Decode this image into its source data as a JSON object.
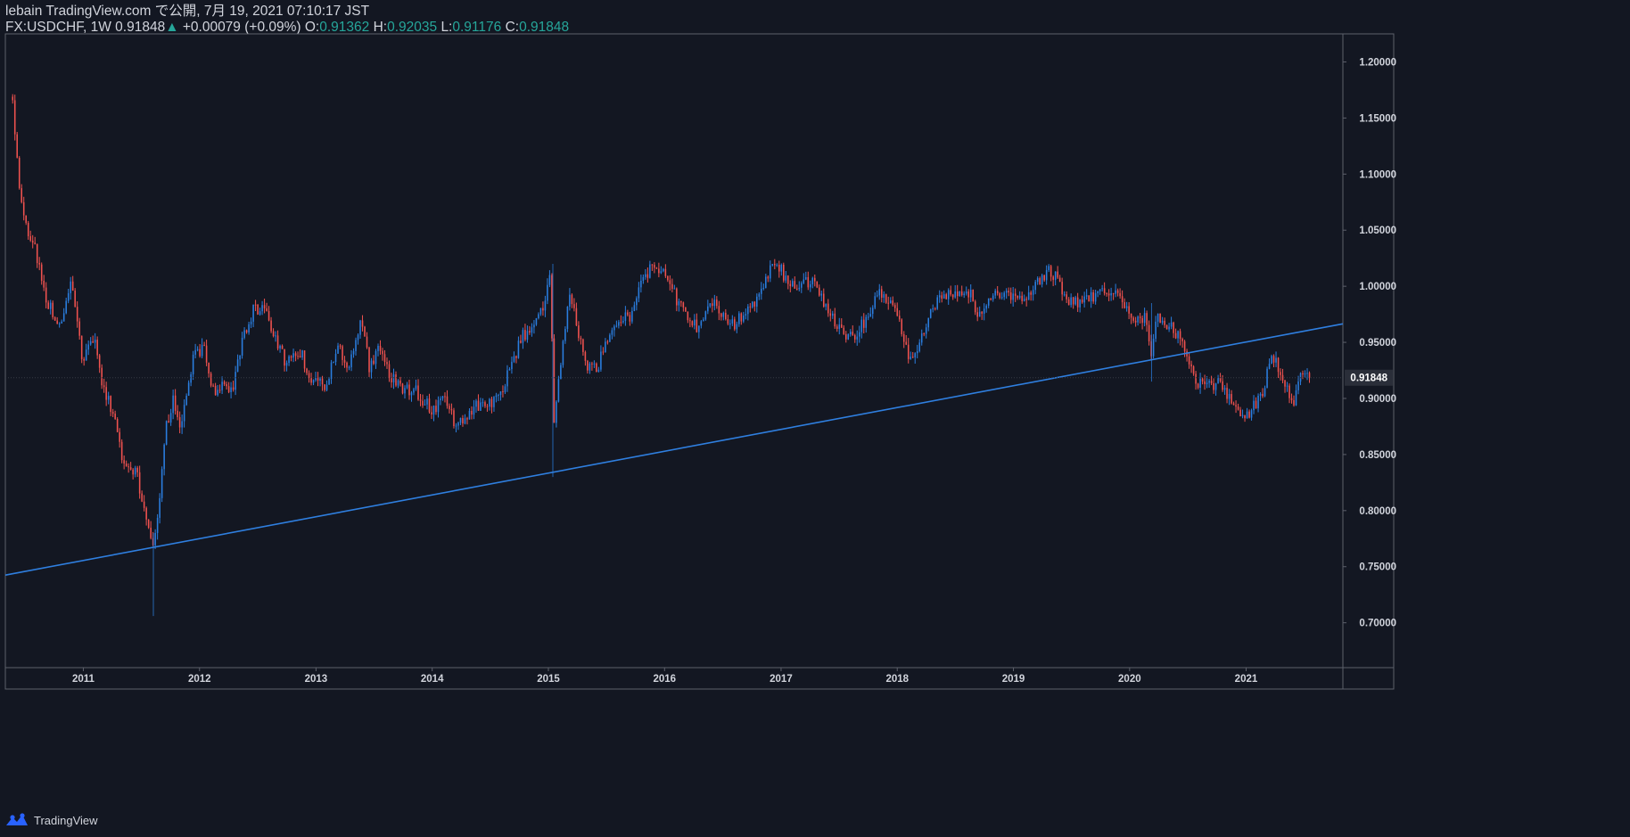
{
  "header": {
    "publish_line": "lebain TradingView.com で公開, 7月 19, 2021 07:10:17 JST",
    "symbol": "FX:USDCHF, 1W",
    "last": "0.91848",
    "change_arrow": "▲",
    "change": "+0.00079 (+0.09%)",
    "o_label": "O:",
    "o_value": "0.91362",
    "h_label": "H:",
    "h_value": "0.92035",
    "l_label": "L:",
    "l_value": "0.91176",
    "c_label": "C:",
    "c_value": "0.91848"
  },
  "footer": {
    "brand": "TradingView",
    "icon": "tradingview-logo-icon"
  },
  "colors": {
    "background": "#131722",
    "up": "#2a7ee0",
    "down": "#f0524f",
    "trendline": "#2f7fe0",
    "text": "#d1d4dc",
    "value_green": "#26a69a",
    "border": "#5d606b"
  },
  "chart_data": {
    "type": "candlestick",
    "timeframe": "1W",
    "x_tick_labels": [
      "2011",
      "2012",
      "2013",
      "2014",
      "2015",
      "2016",
      "2017",
      "2018",
      "2019",
      "2020",
      "2021"
    ],
    "x_range": [
      "2010-05",
      "2021-11"
    ],
    "y_tick_labels": [
      "1.20000",
      "1.15000",
      "1.10000",
      "1.05000",
      "1.00000",
      "0.95000",
      "0.90000",
      "0.85000",
      "0.80000",
      "0.75000",
      "0.70000"
    ],
    "ylim": [
      0.66,
      1.225
    ],
    "last_price_label": "0.91848",
    "last_price": 0.91848,
    "price_path": [
      [
        "2010-05-24",
        1.165
      ],
      [
        "2010-06-10",
        1.1
      ],
      [
        "2010-07-01",
        1.055
      ],
      [
        "2010-08-01",
        1.035
      ],
      [
        "2010-09-10",
        0.985
      ],
      [
        "2010-10-20",
        0.965
      ],
      [
        "2010-11-25",
        1.005
      ],
      [
        "2010-12-30",
        0.935
      ],
      [
        "2011-02-01",
        0.955
      ],
      [
        "2011-03-01",
        0.915
      ],
      [
        "2011-04-01",
        0.89
      ],
      [
        "2011-05-01",
        0.85
      ],
      [
        "2011-06-15",
        0.835
      ],
      [
        "2011-07-20",
        0.79
      ],
      [
        "2011-08-09",
        0.765
      ],
      [
        "2011-08-25",
        0.8
      ],
      [
        "2011-09-15",
        0.87
      ],
      [
        "2011-10-10",
        0.9
      ],
      [
        "2011-11-01",
        0.87
      ],
      [
        "2011-12-10",
        0.935
      ],
      [
        "2012-01-15",
        0.945
      ],
      [
        "2012-02-15",
        0.905
      ],
      [
        "2012-03-15",
        0.91
      ],
      [
        "2012-04-15",
        0.91
      ],
      [
        "2012-05-15",
        0.955
      ],
      [
        "2012-06-20",
        0.98
      ],
      [
        "2012-07-25",
        0.98
      ],
      [
        "2012-08-20",
        0.955
      ],
      [
        "2012-10-01",
        0.93
      ],
      [
        "2012-11-15",
        0.94
      ],
      [
        "2012-12-20",
        0.915
      ],
      [
        "2013-01-30",
        0.91
      ],
      [
        "2013-03-10",
        0.945
      ],
      [
        "2013-04-15",
        0.93
      ],
      [
        "2013-05-20",
        0.97
      ],
      [
        "2013-06-20",
        0.925
      ],
      [
        "2013-07-15",
        0.95
      ],
      [
        "2013-08-15",
        0.925
      ],
      [
        "2013-09-30",
        0.905
      ],
      [
        "2013-11-01",
        0.91
      ],
      [
        "2013-12-31",
        0.89
      ],
      [
        "2014-02-10",
        0.9
      ],
      [
        "2014-03-15",
        0.875
      ],
      [
        "2014-04-15",
        0.88
      ],
      [
        "2014-05-20",
        0.895
      ],
      [
        "2014-06-20",
        0.89
      ],
      [
        "2014-08-01",
        0.905
      ],
      [
        "2014-09-01",
        0.925
      ],
      [
        "2014-10-10",
        0.955
      ],
      [
        "2014-11-20",
        0.965
      ],
      [
        "2014-12-25",
        0.99
      ],
      [
        "2015-01-10",
        1.015
      ],
      [
        "2015-01-15",
        0.865
      ],
      [
        "2015-02-05",
        0.925
      ],
      [
        "2015-03-10",
        1.0
      ],
      [
        "2015-04-01",
        0.96
      ],
      [
        "2015-05-01",
        0.93
      ],
      [
        "2015-06-01",
        0.925
      ],
      [
        "2015-07-10",
        0.955
      ],
      [
        "2015-08-20",
        0.97
      ],
      [
        "2015-09-20",
        0.975
      ],
      [
        "2015-11-01",
        1.01
      ],
      [
        "2015-12-01",
        1.02
      ],
      [
        "2016-01-10",
        1.01
      ],
      [
        "2016-02-10",
        0.985
      ],
      [
        "2016-03-10",
        0.975
      ],
      [
        "2016-04-15",
        0.96
      ],
      [
        "2016-05-20",
        0.99
      ],
      [
        "2016-06-25",
        0.975
      ],
      [
        "2016-08-01",
        0.965
      ],
      [
        "2016-09-10",
        0.975
      ],
      [
        "2016-10-15",
        0.99
      ],
      [
        "2016-11-20",
        1.01
      ],
      [
        "2016-12-15",
        1.025
      ],
      [
        "2017-01-15",
        1.005
      ],
      [
        "2017-02-20",
        1.0
      ],
      [
        "2017-04-01",
        1.005
      ],
      [
        "2017-05-10",
        0.99
      ],
      [
        "2017-06-15",
        0.97
      ],
      [
        "2017-08-01",
        0.955
      ],
      [
        "2017-09-01",
        0.96
      ],
      [
        "2017-10-01",
        0.975
      ],
      [
        "2017-11-10",
        0.995
      ],
      [
        "2017-12-20",
        0.985
      ],
      [
        "2018-01-20",
        0.955
      ],
      [
        "2018-02-10",
        0.93
      ],
      [
        "2018-03-15",
        0.95
      ],
      [
        "2018-04-20",
        0.98
      ],
      [
        "2018-05-20",
        0.995
      ],
      [
        "2018-07-01",
        0.99
      ],
      [
        "2018-08-15",
        0.995
      ],
      [
        "2018-09-20",
        0.97
      ],
      [
        "2018-10-25",
        0.995
      ],
      [
        "2018-12-01",
        0.995
      ],
      [
        "2019-01-15",
        0.99
      ],
      [
        "2019-03-01",
        0.995
      ],
      [
        "2019-04-20",
        1.015
      ],
      [
        "2019-05-20",
        1.005
      ],
      [
        "2019-06-20",
        0.985
      ],
      [
        "2019-08-01",
        0.985
      ],
      [
        "2019-09-01",
        0.99
      ],
      [
        "2019-10-01",
        0.995
      ],
      [
        "2019-11-10",
        0.995
      ],
      [
        "2019-12-20",
        0.98
      ],
      [
        "2020-01-20",
        0.965
      ],
      [
        "2020-02-15",
        0.975
      ],
      [
        "2020-03-10",
        0.935
      ],
      [
        "2020-03-25",
        0.975
      ],
      [
        "2020-05-01",
        0.965
      ],
      [
        "2020-06-01",
        0.955
      ],
      [
        "2020-07-01",
        0.94
      ],
      [
        "2020-07-25",
        0.915
      ],
      [
        "2020-09-01",
        0.91
      ],
      [
        "2020-10-01",
        0.915
      ],
      [
        "2020-11-01",
        0.905
      ],
      [
        "2020-12-20",
        0.885
      ],
      [
        "2021-01-20",
        0.89
      ],
      [
        "2021-02-20",
        0.905
      ],
      [
        "2021-03-15",
        0.93
      ],
      [
        "2021-04-01",
        0.935
      ],
      [
        "2021-05-01",
        0.91
      ],
      [
        "2021-06-01",
        0.898
      ],
      [
        "2021-06-20",
        0.922
      ],
      [
        "2021-07-19",
        0.91848
      ]
    ],
    "trendline": {
      "from": [
        "2010-05-01",
        0.7425
      ],
      "to": [
        "2021-11-01",
        0.9665
      ]
    }
  }
}
